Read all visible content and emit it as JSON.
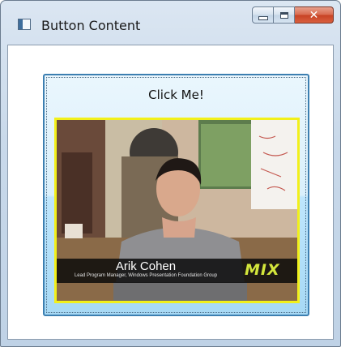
{
  "window": {
    "title": "Button Content",
    "icon": "window-app-icon",
    "controls": {
      "minimize": "minimize-icon",
      "maximize": "maximize-icon",
      "close": "✕"
    }
  },
  "button": {
    "label": "Click Me!",
    "border_color": "#3c7fb1",
    "video": {
      "frame_color": "#f2f01a",
      "caption_name": "Arik Cohen",
      "caption_title": "Lead Program Manager, Windows Presentation Foundation Group",
      "logo": "MIX"
    }
  }
}
